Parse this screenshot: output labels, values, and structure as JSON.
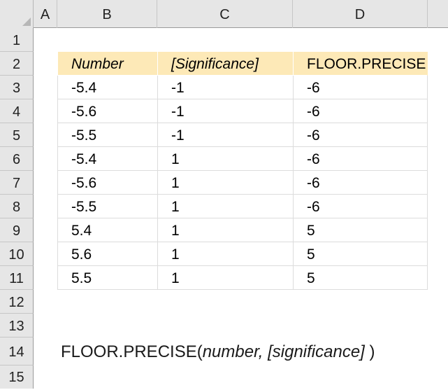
{
  "columns": {
    "a": "A",
    "b": "B",
    "c": "C",
    "d": "D"
  },
  "rows": [
    "1",
    "2",
    "3",
    "4",
    "5",
    "6",
    "7",
    "8",
    "9",
    "10",
    "11",
    "12",
    "13",
    "14",
    "15"
  ],
  "table": {
    "headers": {
      "number": "Number",
      "significance": "[Significance]",
      "result": "FLOOR.PRECISE"
    },
    "data": [
      {
        "number": "-5.4",
        "significance": "-1",
        "result": "-6"
      },
      {
        "number": "-5.6",
        "significance": "-1",
        "result": "-6"
      },
      {
        "number": "-5.5",
        "significance": "-1",
        "result": "-6"
      },
      {
        "number": "-5.4",
        "significance": "1",
        "result": "-6"
      },
      {
        "number": "-5.6",
        "significance": "1",
        "result": "-6"
      },
      {
        "number": "-5.5",
        "significance": "1",
        "result": "-6"
      },
      {
        "number": "5.4",
        "significance": "1",
        "result": "5"
      },
      {
        "number": "5.6",
        "significance": "1",
        "result": "5"
      },
      {
        "number": "5.5",
        "significance": "1",
        "result": "5"
      }
    ]
  },
  "syntax": {
    "func": "FLOOR.PRECISE(",
    "arg1": "number",
    "sep": ", ",
    "arg2": "[significance]",
    "close": " )"
  },
  "colors": {
    "header_fill": "#fde9b7",
    "grid_header_bg": "#e6e6e6"
  }
}
